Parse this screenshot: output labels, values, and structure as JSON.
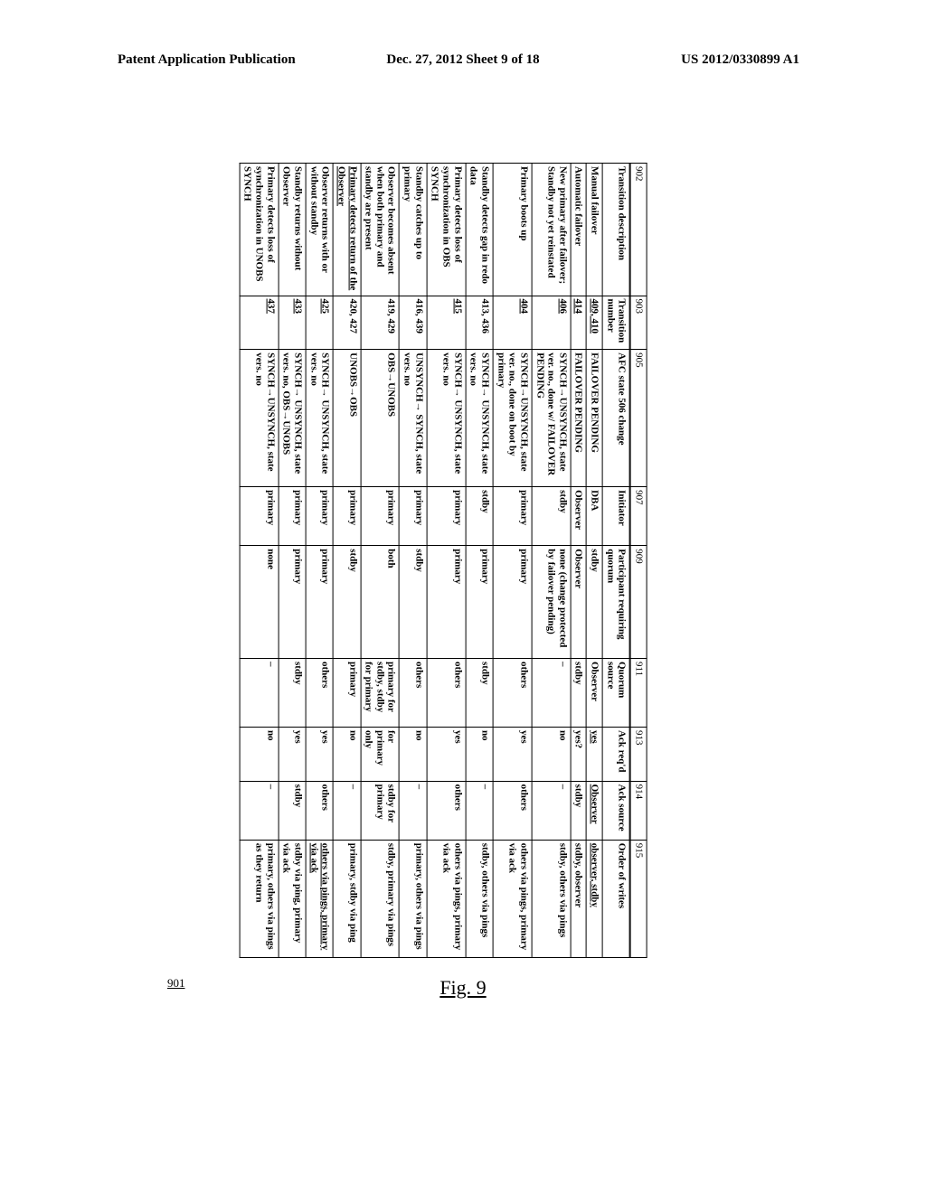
{
  "header": {
    "left": "Patent Application Publication",
    "mid": "Dec. 27, 2012  Sheet 9 of 18",
    "right": "US 2012/0330899 A1"
  },
  "figure": {
    "label": "Fig. 9",
    "ref": "901"
  },
  "col_nums": [
    "902",
    "903",
    "905",
    "907",
    "909",
    "911",
    "913",
    "914",
    "915"
  ],
  "columns": [
    "Transition description",
    "Transition number",
    "AFC state 506 change",
    "Initiator",
    "Participant requiring quorum",
    "Quorum source",
    "Ack req'd",
    "Ack source",
    "Order of writes"
  ],
  "rows": [
    {
      "d": "Manual failover",
      "tn": "409, 410",
      "afc": "FAILOVER PENDING",
      "init": "DBA",
      "part": "stdby",
      "quo": "Observer",
      "ack": "yes",
      "src": "Observer",
      "ord": "observer, stdby",
      "u": {
        "tn": 1,
        "ack": 1,
        "src": 1,
        "ord": 1
      }
    },
    {
      "d": "Automatic failover",
      "tn": "414",
      "afc": "FAILOVER PENDING",
      "init": "Observer",
      "part": "Observer",
      "quo": "stdby",
      "ack": "yes?",
      "src": "stdby",
      "ord": "stdby, observer",
      "u": {
        "tn": 1
      }
    },
    {
      "d": "New primary after failover; Standby not yet reinstated",
      "tn": "406",
      "afc": "SYNCH→UNSYNCH, state ver. no., done w/ FAILOVER PENDING",
      "init": "stdby",
      "part": "none (change protected by failover pending)",
      "quo": "–",
      "ack": "no",
      "src": "–",
      "ord": "stdby, others via pings",
      "u": {
        "tn": 1
      }
    },
    {
      "d": "Primary boots up",
      "tn": "404",
      "afc": "SYNCH→UNSYNCH, state ver. no., done on boot by primary",
      "init": "primary",
      "part": "primary",
      "quo": "others",
      "ack": "yes",
      "src": "others",
      "ord": "others via pings, primary via ack",
      "u": {
        "tn": 1
      }
    },
    {
      "d": "Standby detects gap in redo data",
      "tn": "413, 436",
      "afc": "SYNCH→ UNSYNCH, state vers. no",
      "init": "stdby",
      "part": "primary",
      "quo": "stdby",
      "ack": "no",
      "src": "–",
      "ord": "stdby, others via pings",
      "u": {}
    },
    {
      "d": "Primary detects loss of synchronization in OBS SYNCH",
      "tn": "415",
      "afc": "SYNCH→ UNSYNCH, state vers. no",
      "init": "primary",
      "part": "primary",
      "quo": "others",
      "ack": "yes",
      "src": "others",
      "ord": "others via pings, primary via ack",
      "u": {
        "tn": 1
      }
    },
    {
      "d": "Standby catches up to primary",
      "tn": "416, 439",
      "afc": "UNSYNCH→ SYNCH, state vers. no",
      "init": "primary",
      "part": "stdby",
      "quo": "others",
      "ack": "no",
      "src": "–",
      "ord": "primary, others via pings",
      "u": {}
    },
    {
      "d": "Observer becomes absent when both primary and standby are present",
      "tn": "419, 429",
      "afc": "OBS→UNOBS",
      "init": "primary",
      "part": "both",
      "quo": "primary for stdby, stdby for primary",
      "ack": "for primary only",
      "src": "stdby for primary",
      "ord": "stdby, primary via pings",
      "u": {}
    },
    {
      "d": "Primary detects return of the Observer",
      "tn": "420, 427",
      "afc": "UNOBS→OBS",
      "init": "primary",
      "part": "stdby",
      "quo": "primary",
      "ack": "no",
      "src": "–",
      "ord": "primary, stdby via ping",
      "u": {
        "d": 1
      }
    },
    {
      "d": "Observer returns with or without standby",
      "tn": "425",
      "afc": "SYNCH→ UNSYNCH, state vers. no",
      "init": "primary",
      "part": "primary",
      "quo": "others",
      "ack": "yes",
      "src": "others",
      "ord": "others via pings, primary via ack",
      "u": {
        "tn": 1,
        "ord": 1
      }
    },
    {
      "d": "Standby returns without Observer",
      "tn": "433",
      "afc": "SYNCH→ UNSYNCH, state vers. no, OBS→UNOBS",
      "init": "primary",
      "part": "primary",
      "quo": "stdby",
      "ack": "yes",
      "src": "stdby",
      "ord": "stdby via ping, primary via ack",
      "u": {
        "tn": 1
      }
    },
    {
      "d": "Primary detects loss of synchronization in UNOBS SYNCH",
      "tn": "437",
      "afc": "SYNCH→UNSYNCH, state vers. no",
      "init": "primary",
      "part": "none",
      "quo": "–",
      "ack": "no",
      "src": "–",
      "ord": "primary, others via pings as they return",
      "u": {
        "tn": 1
      }
    }
  ]
}
